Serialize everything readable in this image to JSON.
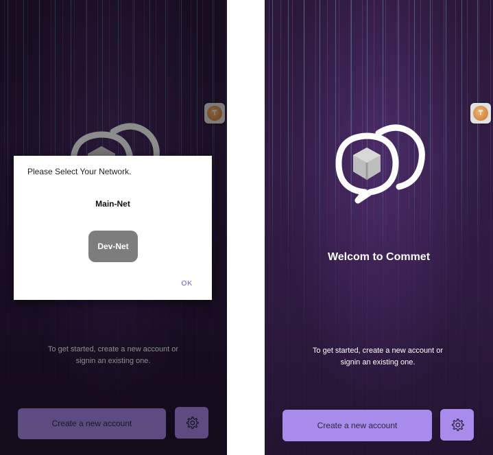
{
  "left_screen": {
    "welcome_text": "",
    "subtitle_line1": "To get started, create a new account or",
    "subtitle_line2": "signin an existing one.",
    "create_button_label": "Create a new account",
    "dialog": {
      "title": "Please Select Your Network.",
      "options": [
        "Main-Net",
        "Dev-Net"
      ],
      "ok_label": "OK"
    }
  },
  "right_screen": {
    "welcome_text": "Welcom to Commet",
    "subtitle_line1": "To get started, create a new account or",
    "subtitle_line2": "signin an existing one.",
    "create_button_label": "Create a new account"
  },
  "icons": [
    "chat-bubbles-cube-logo",
    "gear-icon",
    "coin-avatar-icon"
  ],
  "colors": {
    "background": "#2e1a40",
    "accent_button": "#a98bec",
    "dialog_background": "#ffffff",
    "dev_net_button": "#7d7d7d",
    "ok_text": "#7a4fd8"
  }
}
